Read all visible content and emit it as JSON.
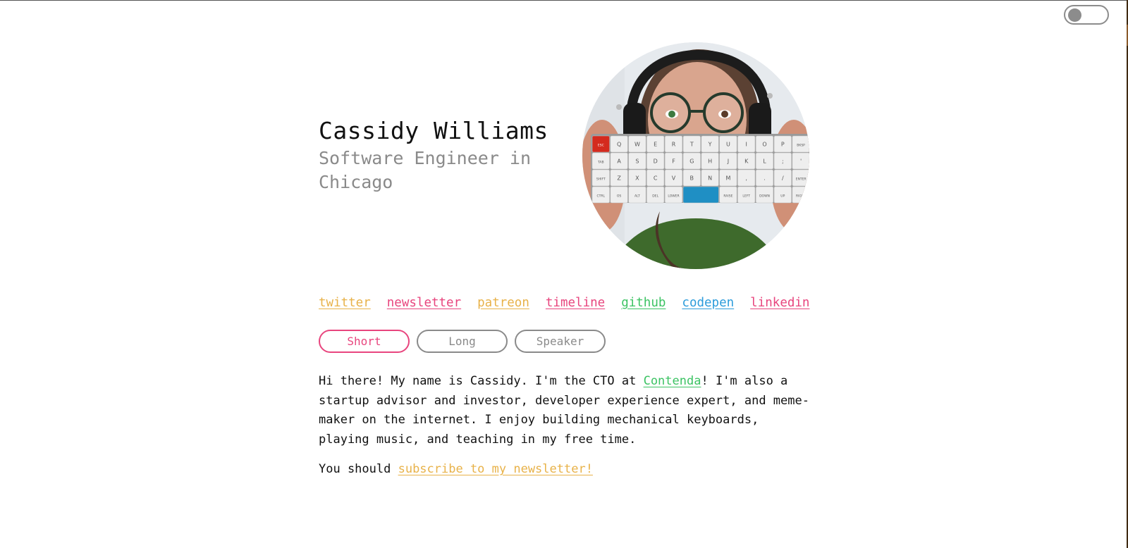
{
  "colors": {
    "yellow": "#e8b249",
    "pink": "#e8457e",
    "green": "#3cc363",
    "blue": "#2c9cdb",
    "gray": "#8a8a8a",
    "text": "#111111"
  },
  "theme_toggle": {
    "state": "off",
    "icon": "toggle-switch-icon"
  },
  "header": {
    "name": "Cassidy Williams",
    "subtitle": "Software Engineer in Chicago",
    "avatar": {
      "description": "Photo of a person with headphones and glasses holding up a mechanical keyboard in front of her face",
      "icon": "avatar-photo"
    }
  },
  "links": [
    {
      "label": "twitter",
      "color": "#e8b249"
    },
    {
      "label": "newsletter",
      "color": "#e8457e"
    },
    {
      "label": "patreon",
      "color": "#e8b249"
    },
    {
      "label": "timeline",
      "color": "#e8457e"
    },
    {
      "label": "github",
      "color": "#3cc363"
    },
    {
      "label": "codepen",
      "color": "#2c9cdb"
    },
    {
      "label": "linkedin",
      "color": "#e8457e"
    }
  ],
  "bio_tabs": [
    {
      "label": "Short",
      "active": true
    },
    {
      "label": "Long",
      "active": false
    },
    {
      "label": "Speaker",
      "active": false
    }
  ],
  "bio": {
    "before_link": "Hi there! My name is Cassidy. I'm the CTO at ",
    "link_label": "Contenda",
    "link_color": "#3cc363",
    "after_link": "! I'm also a startup advisor and investor, developer experience expert, and meme-maker on the internet. I enjoy building mechanical keyboards, playing music, and teaching in my free time."
  },
  "cta": {
    "prefix": "You should ",
    "link_label": "subscribe to my newsletter!",
    "link_color": "#e8b249"
  },
  "keyboard": {
    "rows": [
      [
        "ESC",
        "Q",
        "W",
        "E",
        "R",
        "T",
        "Y",
        "U",
        "I",
        "O",
        "P",
        "BKSP"
      ],
      [
        "TAB",
        "A",
        "S",
        "D",
        "F",
        "G",
        "H",
        "J",
        "K",
        "L",
        ";",
        "'"
      ],
      [
        "SHIFT",
        "Z",
        "X",
        "C",
        "V",
        "B",
        "N",
        "M",
        ",",
        ".",
        "/",
        "ENTER"
      ],
      [
        "CTRL",
        "OS",
        "ALT",
        "DEL",
        "LOWER",
        "",
        "",
        "RAISE",
        "LEFT",
        "DOWN",
        "UP",
        "RIGHT"
      ]
    ]
  }
}
